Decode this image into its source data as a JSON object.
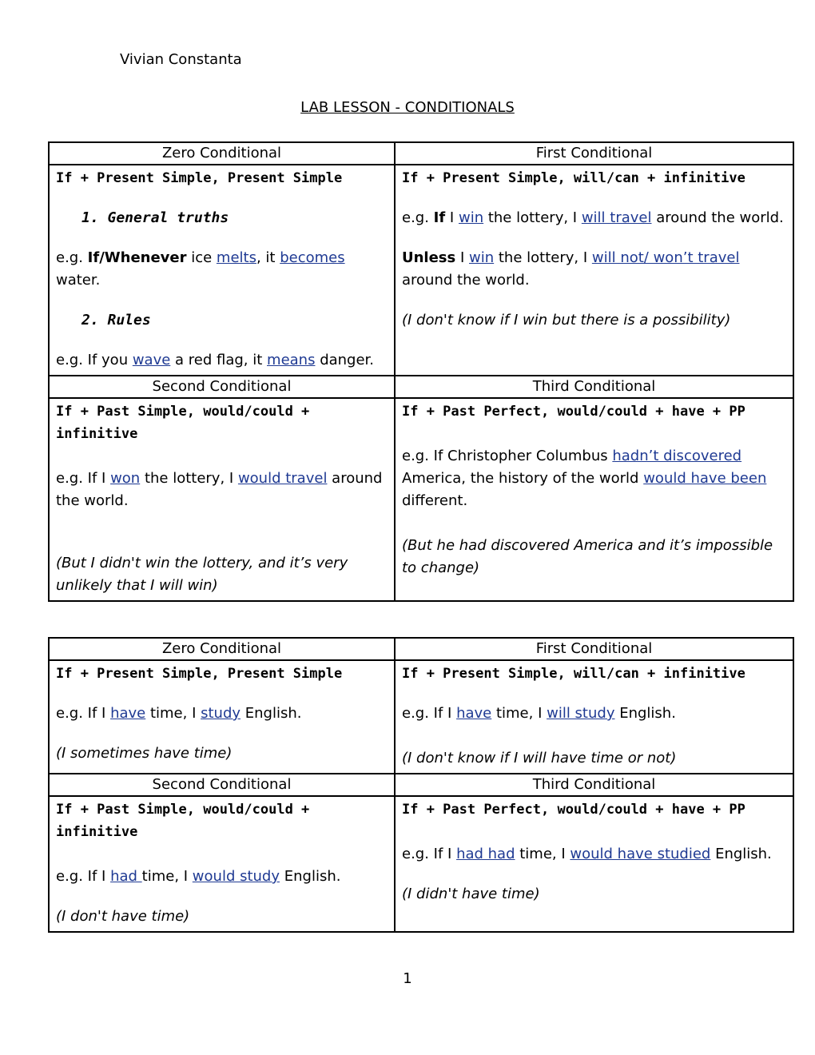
{
  "author": "Vivian Constanta",
  "title": "LAB LESSON - CONDITIONALS",
  "table1": {
    "zero": {
      "header": "Zero Conditional",
      "formula": "If + Present Simple, Present Simple",
      "sub1": "1. General truths",
      "ex1": {
        "pre": "e.g. ",
        "bold": "If/Whenever",
        "a": " ice ",
        "u1": "melts",
        "b": ", it ",
        "u2": "becomes",
        "c": " water."
      },
      "sub2": "2. Rules",
      "ex2": {
        "pre": "e.g. If you ",
        "u1": "wave",
        "a": " a red flag, it ",
        "u2": "means",
        "b": " danger."
      }
    },
    "first": {
      "header": "First Conditional",
      "formula": "If + Present Simple, will/can + infinitive",
      "ex1": {
        "pre": "e.g. ",
        "bold": "If",
        "a": " I ",
        "u1": "win",
        "b": " the lottery, I ",
        "u2": "will travel",
        "c": " around the world."
      },
      "ex2": {
        "bold": "Unless",
        "a": " I ",
        "u1": "win",
        "b": " the lottery, I ",
        "u2": "will not/ won’t travel",
        "c": " around the world."
      },
      "note": "(I don't know if I win but there is a possibility)"
    },
    "second": {
      "header": "Second Conditional",
      "formula": "If + Past Simple, would/could + infinitive",
      "ex": {
        "pre": "e.g. If I ",
        "u1": "won",
        "a": " the lottery, I ",
        "u2": "would travel",
        "b": " around the world."
      },
      "note": "(But I didn't win the lottery, and it’s very unlikely that I will win)"
    },
    "third": {
      "header": "Third Conditional",
      "formula": "If + Past Perfect, would/could + have + PP",
      "ex": {
        "pre": "e.g. If Christopher Columbus ",
        "u1": "hadn’t discovered",
        "a": " America, the history of the world ",
        "u2": "would have been",
        "b": " different."
      },
      "note": "(But he had discovered America and it’s impossible to change)"
    }
  },
  "table2": {
    "zero": {
      "header": "Zero Conditional",
      "formula": "If + Present Simple, Present Simple",
      "ex": {
        "pre": "e.g. If I ",
        "u1": "have",
        "a": " time, I ",
        "u2": "study",
        "b": " English."
      },
      "note": "(I sometimes have time)"
    },
    "first": {
      "header": "First Conditional",
      "formula": "If + Present Simple, will/can + infinitive",
      "ex": {
        "pre": "e.g. If I ",
        "u1": "have",
        "a": " time, I ",
        "u2": "will study",
        "b": " English."
      },
      "note": "(I don't know if I will have time or not)"
    },
    "second": {
      "header": "Second Conditional",
      "formula": "If + Past Simple, would/could + infinitive",
      "ex": {
        "pre": "e.g. If I ",
        "u1": "had ",
        "a": "time, I ",
        "u2": "would study",
        "b": " English."
      },
      "note": "(I don't have time)"
    },
    "third": {
      "header": "Third Conditional",
      "formula": "If + Past Perfect, would/could + have + PP",
      "ex": {
        "pre": "e.g. If I ",
        "u1": "had had",
        "a": " time, I ",
        "u2": "would have studied",
        "b": " English."
      },
      "note": "(I didn't have time)"
    }
  },
  "page_number": "1"
}
